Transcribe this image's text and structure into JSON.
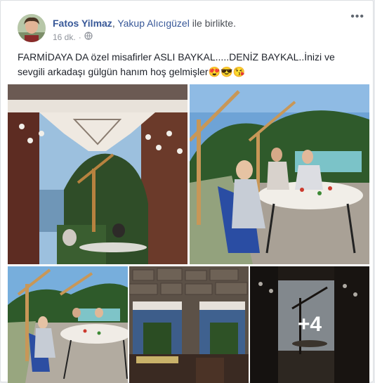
{
  "post": {
    "author": "Fatos Yilmaz",
    "tagged_person": "Yakup Alıcıgüzel",
    "with_text": "ile birlikte.",
    "timestamp": "16 dk.",
    "privacy_icon": "globe-icon",
    "more_icon": "ellipsis-icon",
    "body_text": "FARMİDAYA DA özel misafirler ASLI BAYKAL.....DENİZ BAYKAL..İnizi ve sevgili arkadaşı gülgün hanım hoş gelmişler",
    "emojis": [
      "😍",
      "😎",
      "😘"
    ]
  },
  "photos": {
    "more_count": "+4"
  },
  "colors": {
    "link": "#385898",
    "meta": "#90949c",
    "text": "#1d2129"
  }
}
